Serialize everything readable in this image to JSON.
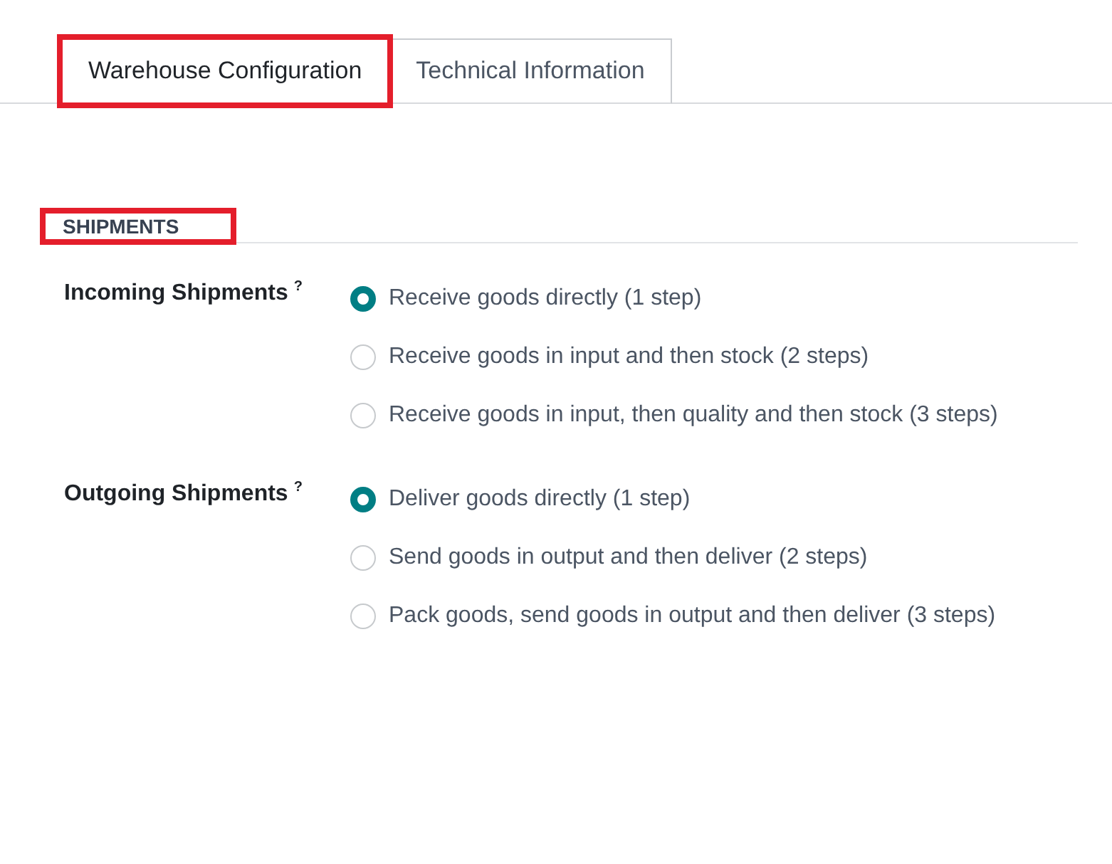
{
  "tabs": [
    {
      "label": "Warehouse Configuration",
      "selected": true,
      "highlighted": true
    },
    {
      "label": "Technical Information",
      "selected": false,
      "highlighted": false
    }
  ],
  "section": {
    "title": "SHIPMENTS",
    "highlighted": true
  },
  "fields": [
    {
      "label": "Incoming Shipments",
      "help": "?",
      "options": [
        {
          "label": "Receive goods directly (1 step)",
          "selected": true
        },
        {
          "label": "Receive goods in input and then stock (2 steps)",
          "selected": false
        },
        {
          "label": "Receive goods in input, then quality and then stock (3 steps)",
          "selected": false
        }
      ]
    },
    {
      "label": "Outgoing Shipments",
      "help": "?",
      "options": [
        {
          "label": "Deliver goods directly (1 step)",
          "selected": true
        },
        {
          "label": "Send goods in output and then deliver (2 steps)",
          "selected": false
        },
        {
          "label": "Pack goods, send goods in output and then deliver (3 steps)",
          "selected": false
        }
      ]
    }
  ]
}
